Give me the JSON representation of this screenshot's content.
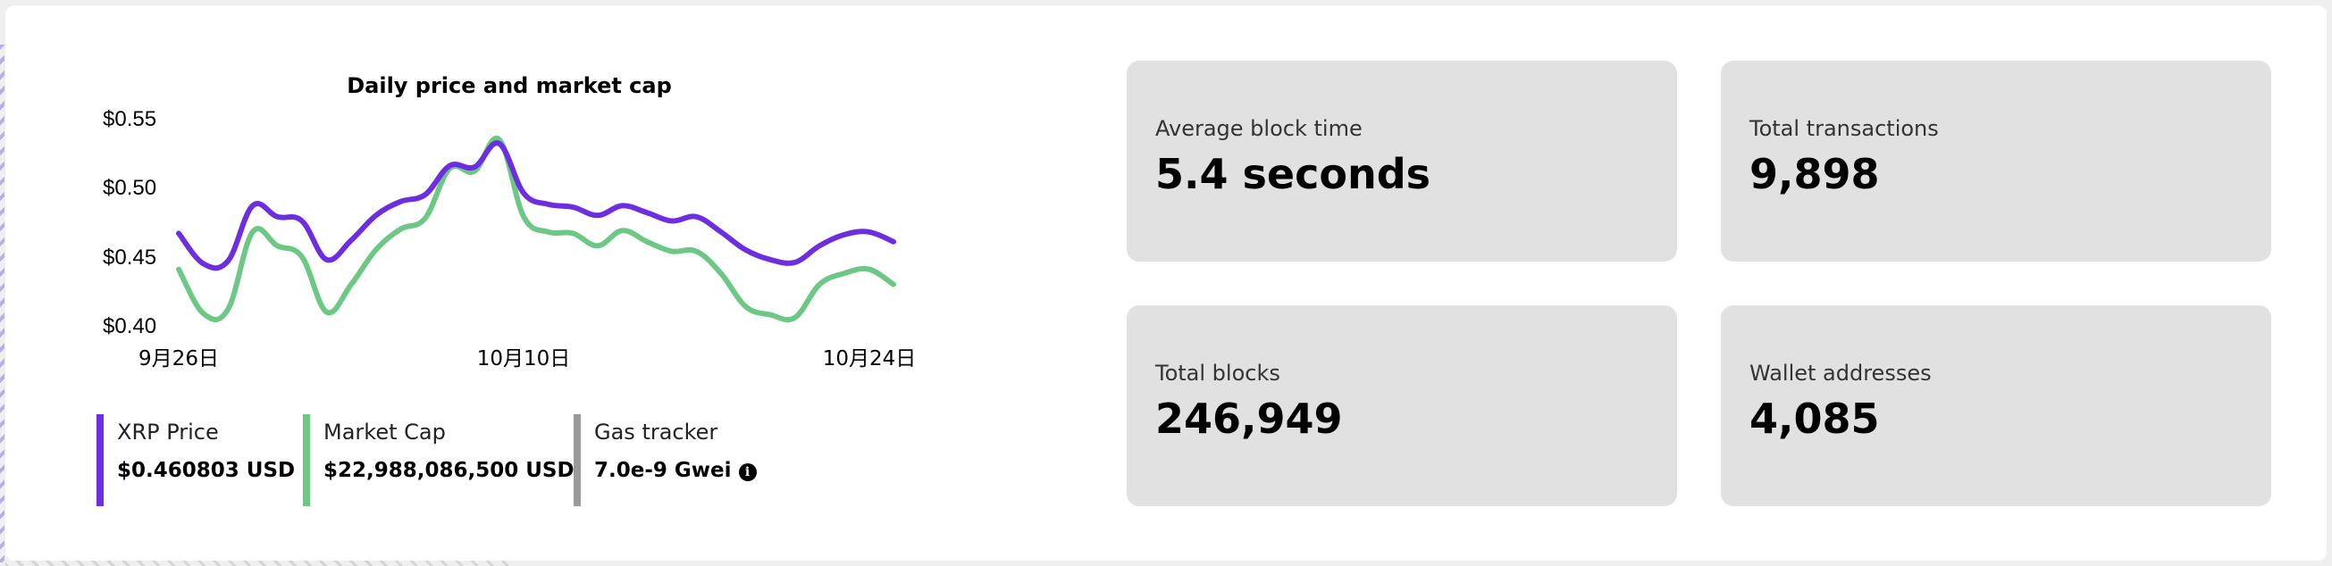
{
  "chart": {
    "title": "Daily price and market cap",
    "y_ticks": [
      "$0.55",
      "$0.50",
      "$0.45",
      "$0.40"
    ],
    "x_ticks": [
      "9月26日",
      "10月10日",
      "10月24日"
    ]
  },
  "chart_data": {
    "type": "line",
    "title": "Daily price and market cap",
    "ylim": [
      0.4,
      0.55
    ],
    "y_ticks": [
      0.55,
      0.5,
      0.45,
      0.4
    ],
    "x_tick_labels": [
      "9月26日",
      "10月10日",
      "10月24日"
    ],
    "x_tick_positions": [
      0,
      14,
      28
    ],
    "x": [
      0,
      1,
      2,
      3,
      4,
      5,
      6,
      7,
      8,
      9,
      10,
      11,
      12,
      13,
      14,
      15,
      16,
      17,
      18,
      19,
      20,
      21,
      22,
      23,
      24,
      25,
      26,
      27,
      28,
      29
    ],
    "series": [
      {
        "name": "XRP Price",
        "color": "#6c2ee0",
        "values": [
          0.467,
          0.445,
          0.447,
          0.487,
          0.479,
          0.476,
          0.448,
          0.462,
          0.48,
          0.49,
          0.495,
          0.516,
          0.515,
          0.532,
          0.496,
          0.488,
          0.486,
          0.48,
          0.487,
          0.482,
          0.476,
          0.479,
          0.468,
          0.455,
          0.448,
          0.446,
          0.458,
          0.466,
          0.468,
          0.461
        ]
      },
      {
        "name": "Market Cap",
        "color": "#6dc785",
        "values": [
          0.441,
          0.409,
          0.412,
          0.468,
          0.458,
          0.45,
          0.41,
          0.43,
          0.455,
          0.47,
          0.478,
          0.514,
          0.512,
          0.535,
          0.479,
          0.468,
          0.467,
          0.458,
          0.469,
          0.461,
          0.454,
          0.454,
          0.438,
          0.414,
          0.408,
          0.406,
          0.43,
          0.438,
          0.441,
          0.43
        ]
      }
    ]
  },
  "legend": {
    "price": {
      "label": "XRP Price",
      "value": "$0.460803 USD",
      "color": "#6c2ee0"
    },
    "marketcap": {
      "label": "Market Cap",
      "value": "$22,988,086,500 USD",
      "color": "#6dc785"
    },
    "gas": {
      "label": "Gas tracker",
      "value": "7.0e-9 Gwei",
      "color": "#9a9a9a",
      "icon": "info-icon"
    }
  },
  "stats": {
    "avg_block_time": {
      "label": "Average block time",
      "value": "5.4 seconds"
    },
    "total_transactions": {
      "label": "Total transactions",
      "value": "9,898"
    },
    "total_blocks": {
      "label": "Total blocks",
      "value": "246,949"
    },
    "wallet_addresses": {
      "label": "Wallet addresses",
      "value": "4,085"
    }
  },
  "colors": {
    "card_bg": "#e1e1e1",
    "panel_bg": "#ffffff",
    "page_bg": "#efefef"
  }
}
